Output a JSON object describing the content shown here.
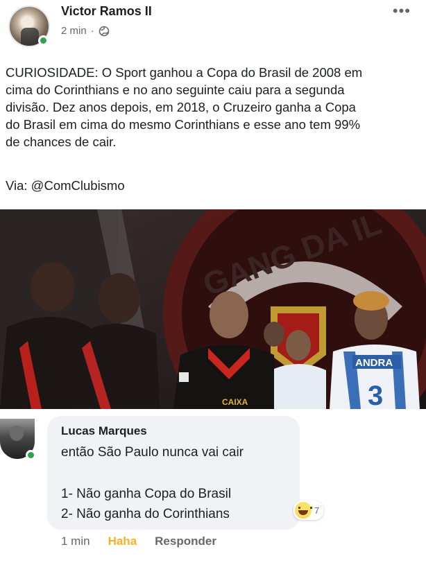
{
  "post": {
    "author": "Victor Ramos II",
    "time": "2 min",
    "separator": "·",
    "privacy_icon": "globe-icon",
    "more_icon": "more-options-icon",
    "text_lines": [
      "CURIOSIDADE: O Sport ganhou a Copa do Brasil de 2008 em",
      "cima do Corinthians e no ano seguinte caiu para a segunda",
      "divisão. Dez anos depois, em 2018, o Cruzeiro ganha a Copa",
      "do Brasil em cima do mesmo Corinthians e esse ano tem 99%",
      "de chances de cair."
    ],
    "via": "Via: @ComClubismo",
    "photo": {
      "banner_text": "GANG DA IL",
      "sponsor_text": "ANDRA",
      "jersey_number": "3"
    }
  },
  "comment": {
    "author": "Lucas Marques",
    "line1": "então São Paulo nunca vai cair",
    "line2": "1- Não ganha Copa do Brasil",
    "line3": "2- Não ganha do Corinthians",
    "reaction_icon": "haha-reaction-icon",
    "reaction_count": "7",
    "time": "1 min",
    "reaction_label": "Haha",
    "reply_label": "Responder"
  },
  "colors": {
    "online": "#31a24c",
    "haha": "#f7b125",
    "secondary_text": "#65676b",
    "bubble": "#f0f2f5"
  }
}
